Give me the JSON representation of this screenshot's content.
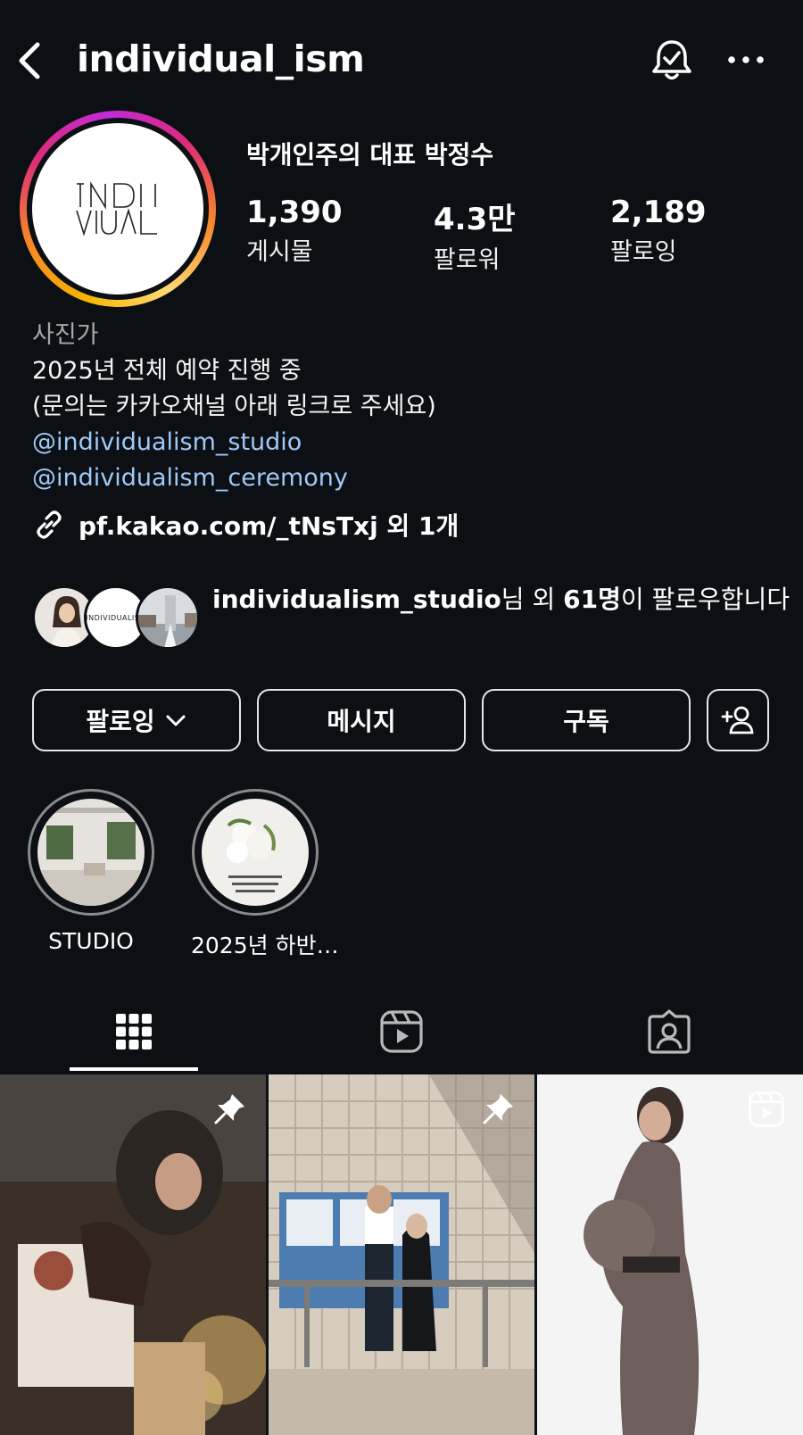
{
  "header": {
    "username": "individual_ism",
    "back_icon": "chevron-left-icon",
    "bell_icon": "notification-bell-check-icon",
    "more_icon": "more-horizontal-icon"
  },
  "profile": {
    "display_name": "박개인주의 대표 박정수",
    "avatar_logo_text": "INDIVIDUAL",
    "stats": [
      {
        "value": "1,390",
        "label": "게시물"
      },
      {
        "value": "4.3만",
        "label": "팔로워"
      },
      {
        "value": "2,189",
        "label": "팔로잉"
      }
    ]
  },
  "bio": {
    "category": "사진가",
    "line1": "2025년 전체 예약 진행 중",
    "line2": "(문의는 카카오채널 아래 링크로 주세요)",
    "mention1": "@individualism_studio",
    "mention2": "@individualism_ceremony",
    "link": "pf.kakao.com/_tNsTxj 외 1개"
  },
  "followed_by": {
    "name": "individualism_studio",
    "mid": "님 외 ",
    "count": "61명",
    "rest": "이 팔로우합니다",
    "mini_avatar_logo": "INDIVIDUALISM"
  },
  "actions": {
    "following": "팔로잉",
    "message": "메시지",
    "subscribe": "구독"
  },
  "highlights": [
    {
      "label": "STUDIO"
    },
    {
      "label": "2025년 하반…"
    }
  ],
  "tabs": [
    "grid-icon",
    "reels-icon",
    "tagged-icon"
  ],
  "colors": {
    "background": "#0c0f14",
    "mention": "#9fc9f8",
    "category": "#a8a8a8"
  }
}
